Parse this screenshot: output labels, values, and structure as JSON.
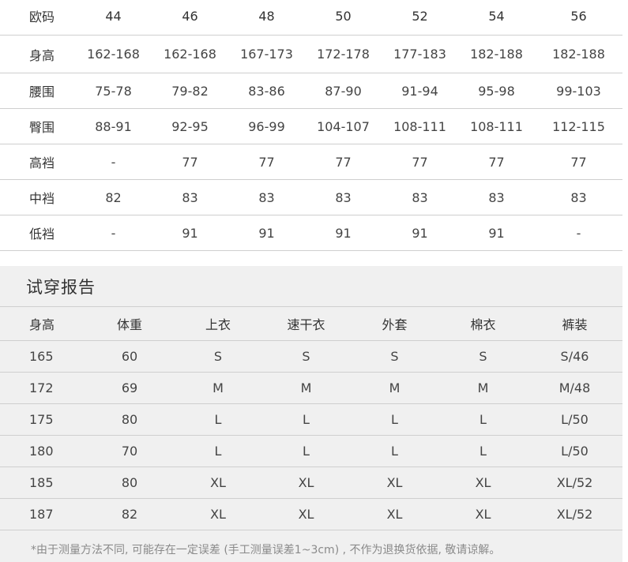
{
  "size_chart": {
    "header_label": "欧码",
    "sizes": [
      "44",
      "46",
      "48",
      "50",
      "52",
      "54",
      "56"
    ],
    "rows": [
      {
        "label": "身高",
        "values": [
          "162-168",
          "162-168",
          "167-173",
          "172-178",
          "177-183",
          "182-188",
          "182-188"
        ]
      },
      {
        "label": "腰围",
        "values": [
          "75-78",
          "79-82",
          "83-86",
          "87-90",
          "91-94",
          "95-98",
          "99-103"
        ]
      },
      {
        "label": "臀围",
        "values": [
          "88-91",
          "92-95",
          "96-99",
          "104-107",
          "108-111",
          "108-111",
          "112-115"
        ]
      },
      {
        "label": "高裆",
        "values": [
          "-",
          "77",
          "77",
          "77",
          "77",
          "77",
          "77"
        ]
      },
      {
        "label": "中裆",
        "values": [
          "82",
          "83",
          "83",
          "83",
          "83",
          "83",
          "83"
        ]
      },
      {
        "label": "低裆",
        "values": [
          "-",
          "91",
          "91",
          "91",
          "91",
          "91",
          "-"
        ]
      }
    ],
    "header_label_color": "#e8202b"
  },
  "fit_report": {
    "title": "试穿报告",
    "columns": [
      "身高",
      "体重",
      "上衣",
      "速干衣",
      "外套",
      "棉衣",
      "裤装"
    ],
    "rows": [
      [
        "165",
        "60",
        "S",
        "S",
        "S",
        "S",
        "S/46"
      ],
      [
        "172",
        "69",
        "M",
        "M",
        "M",
        "M",
        "M/48"
      ],
      [
        "175",
        "80",
        "L",
        "L",
        "L",
        "L",
        "L/50"
      ],
      [
        "180",
        "70",
        "L",
        "L",
        "L",
        "L",
        "L/50"
      ],
      [
        "185",
        "80",
        "XL",
        "XL",
        "XL",
        "XL",
        "XL/52"
      ],
      [
        "187",
        "82",
        "XL",
        "XL",
        "XL",
        "XL",
        "XL/52"
      ]
    ],
    "note": "*由于测量方法不同, 可能存在一定误差 (手工测量误差1~3cm) , 不作为退换货依据, 敬请谅解。",
    "background_color": "#f0f0f0"
  }
}
